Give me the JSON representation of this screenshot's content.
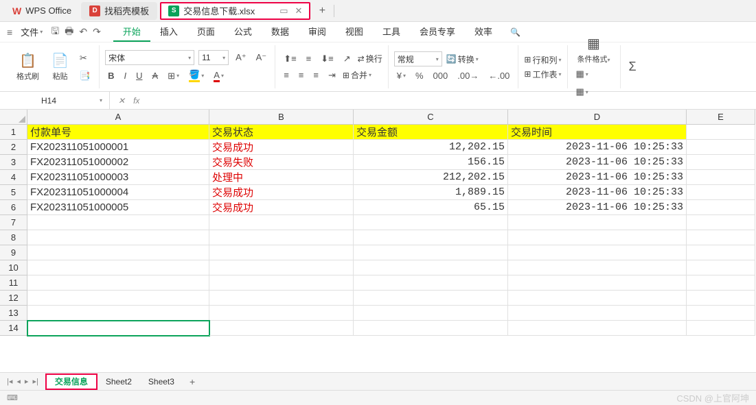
{
  "tabs": {
    "wps": "WPS Office",
    "template": "找稻壳模板",
    "file": "交易信息下载.xlsx"
  },
  "menu": {
    "file": "文件",
    "items": [
      "开始",
      "插入",
      "页面",
      "公式",
      "数据",
      "审阅",
      "视图",
      "工具",
      "会员专享",
      "效率"
    ],
    "active": 0
  },
  "ribbon": {
    "format_painter": "格式刷",
    "paste": "粘贴",
    "font": "宋体",
    "size": "11",
    "bold": "B",
    "italic": "I",
    "underline": "U",
    "strike": "S",
    "wrap": "换行",
    "merge": "合并",
    "general": "常规",
    "convert": "转换",
    "rowcol": "行和列",
    "worksheet": "工作表",
    "condfmt": "条件格式",
    "sum": "Σ"
  },
  "namebox": "H14",
  "fx": "fx",
  "columns": [
    "A",
    "B",
    "C",
    "D",
    "E"
  ],
  "rows": [
    1,
    2,
    3,
    4,
    5,
    6,
    7,
    8,
    9,
    10,
    11,
    12,
    13,
    14
  ],
  "headers": [
    "付款单号",
    "交易状态",
    "交易金额",
    "交易时间"
  ],
  "data": [
    {
      "id": "FX202311051000001",
      "status": "交易成功",
      "amount": "12,202.15",
      "time": "2023-11-06 10:25:33"
    },
    {
      "id": "FX202311051000002",
      "status": "交易失败",
      "amount": "156.15",
      "time": "2023-11-06 10:25:33"
    },
    {
      "id": "FX202311051000003",
      "status": "处理中",
      "amount": "212,202.15",
      "time": "2023-11-06 10:25:33"
    },
    {
      "id": "FX202311051000004",
      "status": "交易成功",
      "amount": "1,889.15",
      "time": "2023-11-06 10:25:33"
    },
    {
      "id": "FX202311051000005",
      "status": "交易成功",
      "amount": "65.15",
      "time": "2023-11-06 10:25:33"
    }
  ],
  "sheets": [
    "交易信息",
    "Sheet2",
    "Sheet3"
  ],
  "watermark": "CSDN @上官阿坤"
}
